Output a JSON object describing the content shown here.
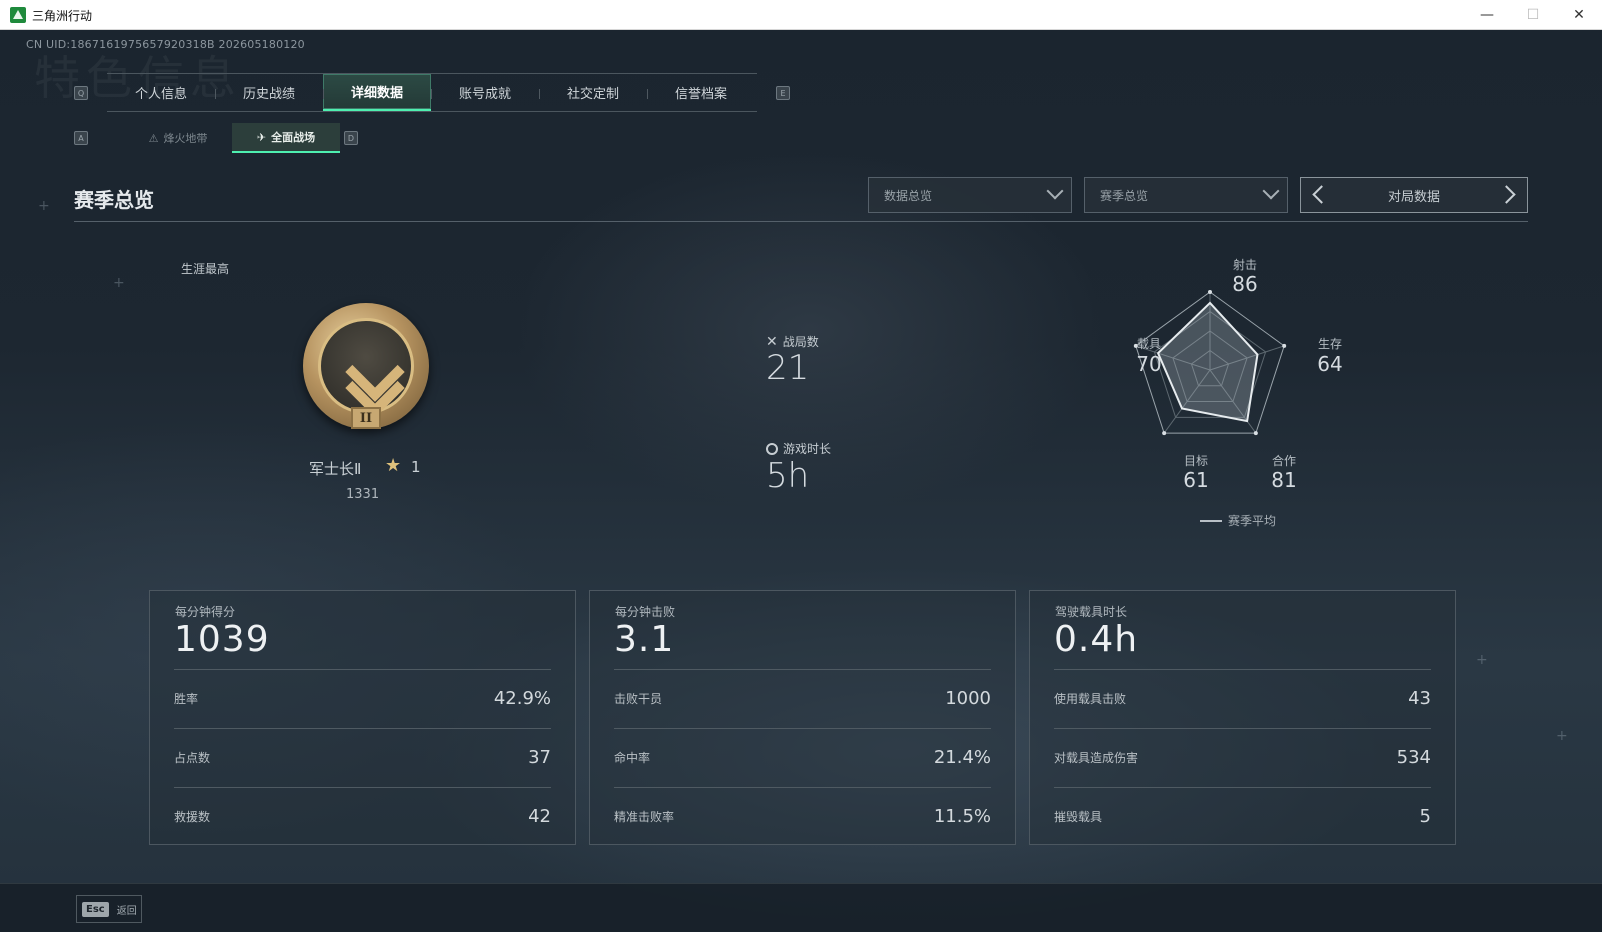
{
  "window": {
    "title": "三角洲行动",
    "minimize": "—",
    "maximize": "☐",
    "close": "✕"
  },
  "uid": "CN UID:1867161975657920318B 202605180120",
  "watermark": "特色信息",
  "keys": {
    "prev_tab": "Q",
    "next_tab": "E",
    "prev_sub": "A",
    "next_sub": "D"
  },
  "main_tabs": [
    {
      "label": "个人信息",
      "active": false
    },
    {
      "label": "历史战绩",
      "active": false
    },
    {
      "label": "详细数据",
      "active": true
    },
    {
      "label": "账号成就",
      "active": false
    },
    {
      "label": "社交定制",
      "active": false
    },
    {
      "label": "信誉档案",
      "active": false
    }
  ],
  "sub_tabs": [
    {
      "label": "烽火地带",
      "icon": "hazard-zone-icon",
      "active": false
    },
    {
      "label": "全面战场",
      "icon": "battlefield-icon",
      "active": true
    }
  ],
  "section": {
    "title": "赛季总览",
    "dropdown_data": "数据总览",
    "dropdown_season": "赛季总览",
    "pager_label": "对局数据"
  },
  "career": {
    "label": "生涯最高",
    "rank_name": "军士长Ⅱ",
    "badge_roman": "II",
    "stars": "1",
    "score": "1331"
  },
  "center_stats": {
    "matches_label": "战局数",
    "matches_value": "21",
    "playtime_label": "游戏时长",
    "playtime_value": "5h"
  },
  "radar": {
    "axes": [
      {
        "label": "射击",
        "value": 86
      },
      {
        "label": "生存",
        "value": 64
      },
      {
        "label": "合作",
        "value": 81
      },
      {
        "label": "目标",
        "value": 61
      },
      {
        "label": "载具",
        "value": 70
      }
    ],
    "legend": "赛季平均",
    "max": 100
  },
  "cards": [
    {
      "head_label": "每分钟得分",
      "head_value": "1039",
      "rows": [
        {
          "label": "胜率",
          "value": "42.9%"
        },
        {
          "label": "占点数",
          "value": "37"
        },
        {
          "label": "救援数",
          "value": "42"
        }
      ]
    },
    {
      "head_label": "每分钟击败",
      "head_value": "3.1",
      "rows": [
        {
          "label": "击败干员",
          "value": "1000"
        },
        {
          "label": "命中率",
          "value": "21.4%"
        },
        {
          "label": "精准击败率",
          "value": "11.5%"
        }
      ]
    },
    {
      "head_label": "驾驶载具时长",
      "head_value": "0.4h",
      "rows": [
        {
          "label": "使用载具击败",
          "value": "43"
        },
        {
          "label": "对载具造成伤害",
          "value": "534"
        },
        {
          "label": "摧毁载具",
          "value": "5"
        }
      ]
    }
  ],
  "footer": {
    "esc_key": "Esc",
    "back_label": "返回"
  },
  "colors": {
    "accent": "#4ef0b0",
    "gold": "#d6b57a"
  }
}
